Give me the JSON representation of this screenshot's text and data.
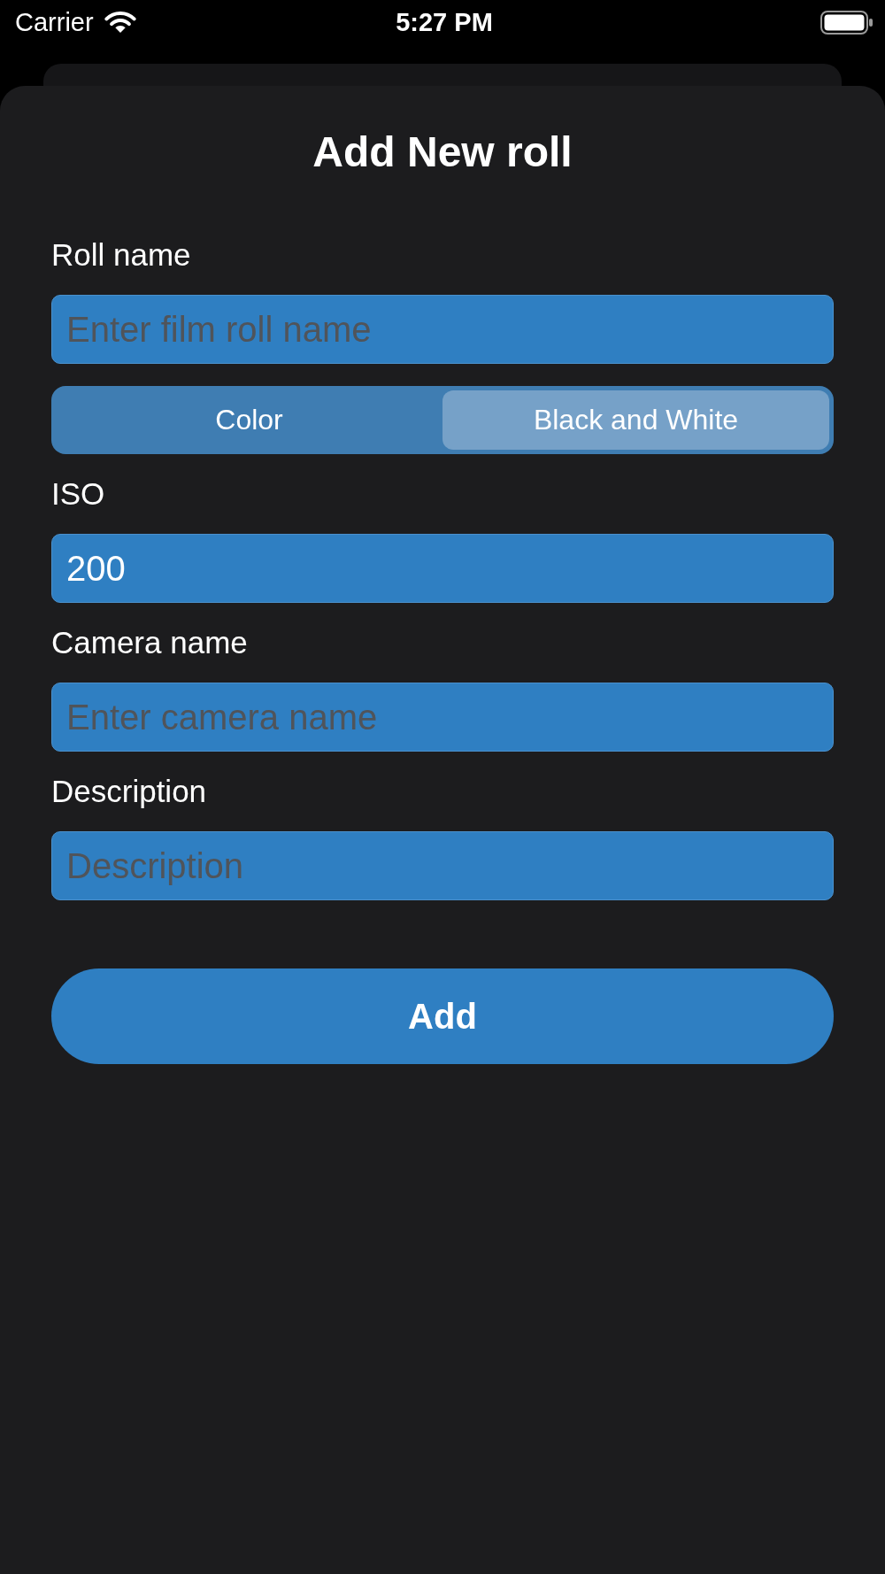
{
  "status_bar": {
    "carrier": "Carrier",
    "time": "5:27 PM"
  },
  "sheet": {
    "title": "Add New roll"
  },
  "form": [
    {
      "kind": "text_field",
      "label": "Roll name",
      "placeholder": "Enter film roll name"
    },
    {
      "kind": "segmented",
      "segments": [
        {
          "label": "Color",
          "selected": false
        },
        {
          "label": "Black and White",
          "selected": true
        }
      ]
    },
    {
      "kind": "text_field",
      "label": "ISO",
      "value": "200"
    },
    {
      "kind": "text_field",
      "label": "Camera name",
      "placeholder": "Enter camera name"
    },
    {
      "kind": "text_field",
      "label": "Description",
      "placeholder": "Description"
    }
  ],
  "add_button": {
    "label": "Add"
  }
}
